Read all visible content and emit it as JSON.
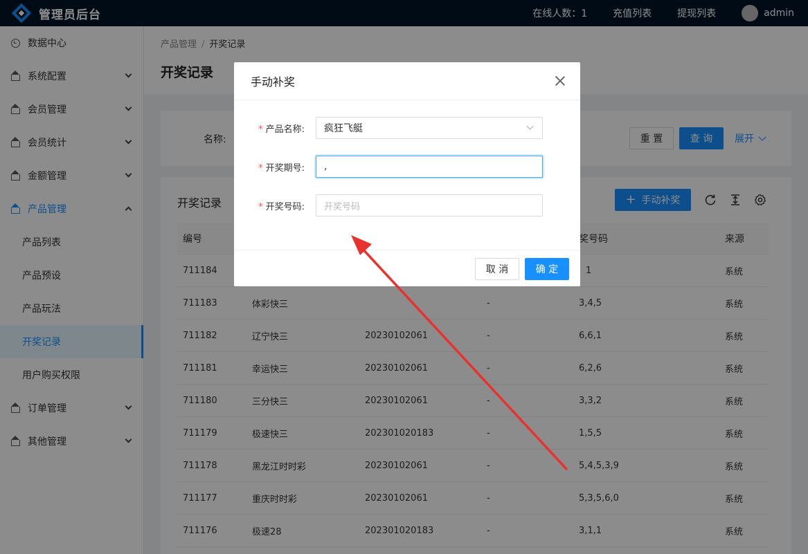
{
  "header": {
    "app_title": "管理员后台",
    "online_count": "在线人数：1",
    "recharge_list": "充值列表",
    "withdraw_list": "提现列表",
    "user_name": "admin"
  },
  "sidebar": {
    "items": [
      {
        "label": "数据中心"
      },
      {
        "label": "系统配置"
      },
      {
        "label": "会员管理"
      },
      {
        "label": "会员统计"
      },
      {
        "label": "金额管理"
      },
      {
        "label": "产品管理"
      },
      {
        "label": "订单管理"
      },
      {
        "label": "其他管理"
      }
    ],
    "sub_items": [
      {
        "label": "产品列表"
      },
      {
        "label": "产品预设"
      },
      {
        "label": "产品玩法"
      },
      {
        "label": "开奖记录"
      },
      {
        "label": "用户购买权限"
      }
    ]
  },
  "breadcrumb": {
    "parent": "产品管理",
    "separator": "/",
    "current": "开奖记录"
  },
  "page_title": "开奖记录",
  "search": {
    "name_label": "名称:",
    "reset_label": "重 置",
    "query_label": "查 询",
    "expand_label": "展开"
  },
  "table": {
    "title": "开奖记录",
    "add_button": "手动补奖",
    "columns": [
      "编号",
      "",
      "",
      "",
      "奖号码",
      "来源"
    ],
    "rows": [
      {
        "id": "711184",
        "name": "",
        "period": "",
        "extra": "",
        "numbers": "1",
        "source": "系统"
      },
      {
        "id": "711183",
        "name": "体彩快三",
        "period": "",
        "extra": "-",
        "numbers": "3,4,5",
        "source": "系统"
      },
      {
        "id": "711182",
        "name": "辽宁快三",
        "period": "20230102061",
        "extra": "-",
        "numbers": "6,6,1",
        "source": "系统"
      },
      {
        "id": "711181",
        "name": "幸运快三",
        "period": "20230102061",
        "extra": "-",
        "numbers": "6,2,6",
        "source": "系统"
      },
      {
        "id": "711180",
        "name": "三分快三",
        "period": "20230102061",
        "extra": "-",
        "numbers": "3,3,2",
        "source": "系统"
      },
      {
        "id": "711179",
        "name": "极速快三",
        "period": "202301020183",
        "extra": "-",
        "numbers": "1,5,5",
        "source": "系统"
      },
      {
        "id": "711178",
        "name": "黑龙江时时彩",
        "period": "20230102061",
        "extra": "-",
        "numbers": "5,4,5,3,9",
        "source": "系统"
      },
      {
        "id": "711177",
        "name": "重庆时时彩",
        "period": "20230102061",
        "extra": "-",
        "numbers": "5,3,5,6,0",
        "source": "系统"
      },
      {
        "id": "711176",
        "name": "极速28",
        "period": "202301020183",
        "extra": "-",
        "numbers": "3,1,1",
        "source": "系统"
      }
    ]
  },
  "modal": {
    "title": "手动补奖",
    "fields": {
      "product_name": {
        "label": "产品名称:",
        "value": "疯狂飞艇"
      },
      "period": {
        "label": "开奖期号:",
        "value": ","
      },
      "numbers": {
        "label": "开奖号码:",
        "placeholder": "开奖号码"
      }
    },
    "cancel_label": "取 消",
    "confirm_label": "确 定"
  },
  "colors": {
    "accent": "#1890ff",
    "header_bg": "#001529",
    "required": "#ff4d4f",
    "annotation": "#e8322e"
  }
}
